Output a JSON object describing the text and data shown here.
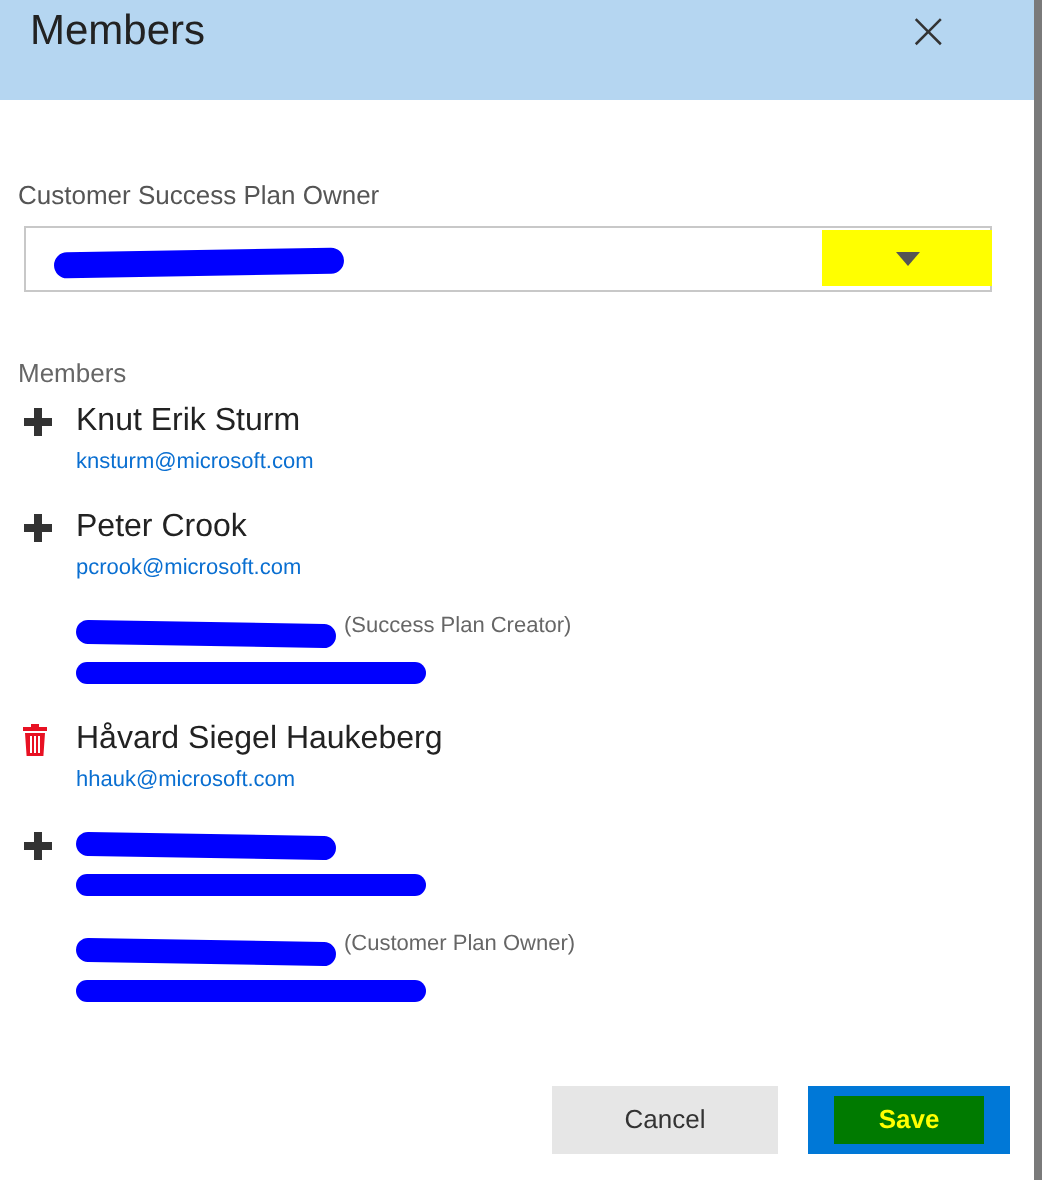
{
  "dialog": {
    "title": "Members",
    "close": "×"
  },
  "owner_field": {
    "label": "Customer Success Plan Owner",
    "value_redacted": true,
    "caret_highlighted": true
  },
  "members_label": "Members",
  "members": [
    {
      "kind": "add",
      "name": "Knut Erik Sturm",
      "email": "knsturm@microsoft.com",
      "redacted": false
    },
    {
      "kind": "add",
      "name": "Peter Crook",
      "email": "pcrook@microsoft.com",
      "redacted": false
    },
    {
      "kind": "plain",
      "role": "(Success Plan Creator)",
      "redacted": true
    },
    {
      "kind": "delete",
      "name": "Håvard Siegel Haukeberg",
      "email": "hhauk@microsoft.com",
      "redacted": false
    },
    {
      "kind": "add",
      "redacted": true
    },
    {
      "kind": "plain",
      "role": "(Customer Plan Owner)",
      "redacted": true
    }
  ],
  "buttons": [
    {
      "label": "Cancel",
      "kind": "secondary"
    },
    {
      "label": "Save",
      "kind": "primary",
      "highlighted": true
    }
  ]
}
